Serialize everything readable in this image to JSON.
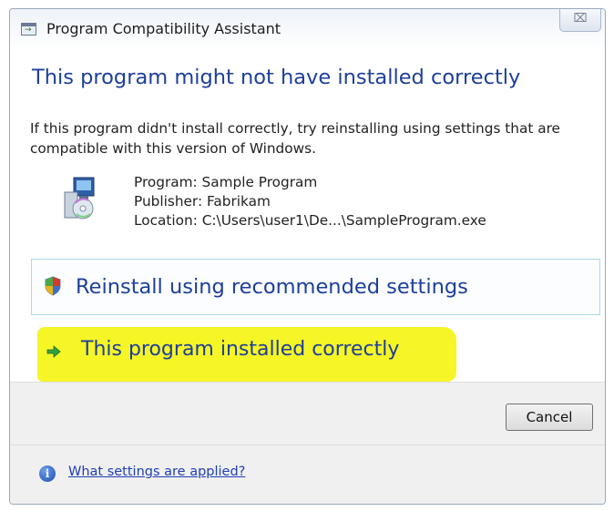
{
  "window": {
    "title": "Program Compatibility Assistant",
    "close_symbol": "⌧"
  },
  "main": {
    "heading": "This program might not have installed correctly",
    "description": "If this program didn't install correctly, try reinstalling using settings that are compatible with this version of Windows.",
    "program_icon": "installer-icon",
    "program_line": "Program: Sample Program",
    "publisher_line": "Publisher: Fabrikam",
    "location_line": "Location: C:\\Users\\user1\\De...\\SampleProgram.exe"
  },
  "options": {
    "reinstall": {
      "icon": "shield-icon",
      "label": "Reinstall using recommended settings"
    },
    "installed_correctly": {
      "icon": "green-arrow-icon",
      "label": "This program installed correctly",
      "highlight_color": "#f6f526"
    }
  },
  "footer": {
    "cancel_label": "Cancel",
    "info_icon": "info-icon",
    "info_glyph": "i",
    "link_text": "What settings are applied?"
  },
  "colors": {
    "heading": "#1d3f9b",
    "link": "#1f3fb5",
    "footer_bg": "#f0f0f0"
  }
}
